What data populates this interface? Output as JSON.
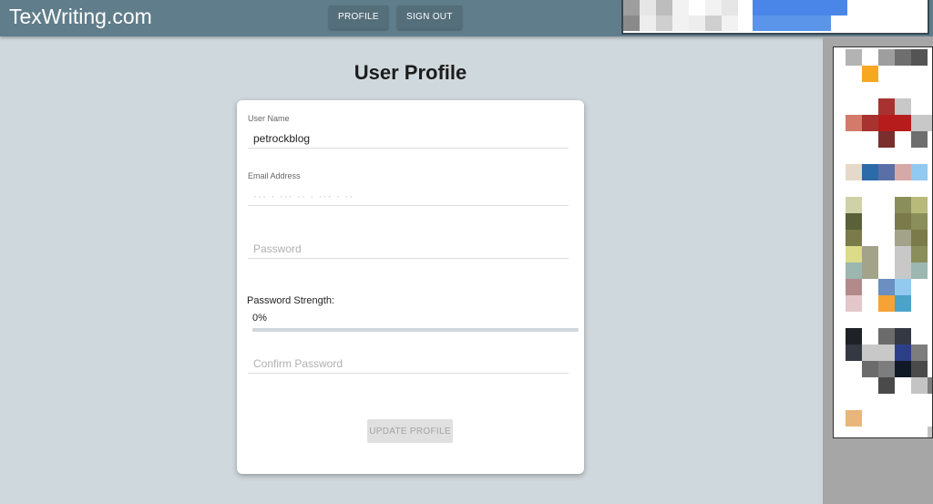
{
  "header": {
    "brand": "TexWriting.com",
    "nav": {
      "profile_label": "PROFILE",
      "signout_label": "SIGN OUT"
    }
  },
  "page": {
    "title": "User Profile"
  },
  "form": {
    "username": {
      "label": "User Name",
      "value": "petrockblog"
    },
    "email": {
      "label": "Email Address",
      "value": "··· · ··· ·· · ··· · ··"
    },
    "password": {
      "placeholder": "Password"
    },
    "strength": {
      "label": "Password Strength:",
      "value_text": "0%",
      "fraction": 0
    },
    "confirm": {
      "placeholder": "Confirm Password"
    },
    "update_label": "UPDATE PROFILE"
  },
  "colors": {
    "topbar": "#607d8b",
    "background": "#cfd8dc",
    "button": "#546e7a"
  },
  "thumbnails": {
    "top_palette": [
      "#9e9e9e",
      "#e6e6e6",
      "#bdbdbd",
      "#f2f2f2",
      "#8a8a8a",
      "#ededed",
      "#cfcfcf",
      "#4a86e8",
      "#5b95ea",
      "#ffffff"
    ],
    "side_palette": [
      "#b3b3b3",
      "#ffffff",
      "#9e9e9e",
      "#6e6e6e",
      "#545454",
      "#f6a821",
      "#c8c8c8",
      "#a8322f",
      "#d47a6a",
      "#b71c1c",
      "#7a2e2e",
      "#e6d9c9",
      "#2d6aa8",
      "#5a6fa6",
      "#d6a9a6",
      "#92c9ef",
      "#cfd2a6",
      "#5a6038",
      "#8a8e5a",
      "#b7ba7a",
      "#7a7a4a",
      "#dbdb8a",
      "#a3a38a",
      "#9cb6b0",
      "#b38a8a",
      "#6a8fc0",
      "#e3c7cb",
      "#f6a235",
      "#4aa3c8",
      "#1e2226",
      "#6b6b6b",
      "#333842",
      "#2e3f8a",
      "#7d7d7d",
      "#0f1a26",
      "#4a4a4a",
      "#c4c4c4",
      "#e8b67a"
    ]
  }
}
